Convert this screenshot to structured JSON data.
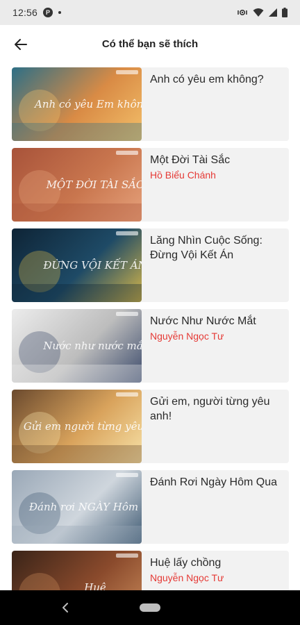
{
  "status_bar": {
    "time": "12:56",
    "app_icon_letter": "P"
  },
  "app_bar": {
    "title": "Có thể bạn sẽ thích",
    "back_icon": "arrow-back-icon"
  },
  "items": [
    {
      "title": "Anh có yêu em không?",
      "author": "",
      "thumb_text": "Anh có yêu Em không?",
      "colors": [
        "#2d6f86",
        "#d98b45",
        "#f3c06a"
      ]
    },
    {
      "title": "Một Đời Tài Sắc",
      "author": "Hồ Biểu Chánh",
      "thumb_text": "MỘT ĐỜI TÀI SẮC",
      "colors": [
        "#a8533a",
        "#c9764e",
        "#e6a27c"
      ]
    },
    {
      "title": "Lăng Nhìn Cuộc Sống: Đừng Vội Kết Án",
      "author": "",
      "thumb_text": "ĐỪNG VỘI KẾT ÁN",
      "colors": [
        "#0e2436",
        "#1e4a66",
        "#d8b84a"
      ]
    },
    {
      "title": "Nước Như Nước Mắt",
      "author": "Nguyễn Ngọc Tư",
      "thumb_text": "Nước như nước mắt",
      "colors": [
        "#ececec",
        "#bdbdbd",
        "#3b4a6b"
      ]
    },
    {
      "title": "Gửi em, người từng yêu anh!",
      "author": "",
      "thumb_text": "Gửi em người từng yêu anh",
      "colors": [
        "#6b4a2e",
        "#d9a35c",
        "#f7e2a8"
      ]
    },
    {
      "title": "Đánh Rơi Ngày Hôm Qua",
      "author": "",
      "thumb_text": "Đánh rơi NGÀY Hôm qua",
      "colors": [
        "#9aa8b7",
        "#cfd6dd",
        "#3f5a73"
      ]
    },
    {
      "title": "Huệ lấy chồng",
      "author": "Nguyễn Ngọc Tư",
      "thumb_text": "Huệ",
      "colors": [
        "#3a2418",
        "#8a4a2c",
        "#c98a5a"
      ]
    }
  ],
  "theme": {
    "author_color": "#e53935",
    "card_bg": "#f2f2f2"
  }
}
